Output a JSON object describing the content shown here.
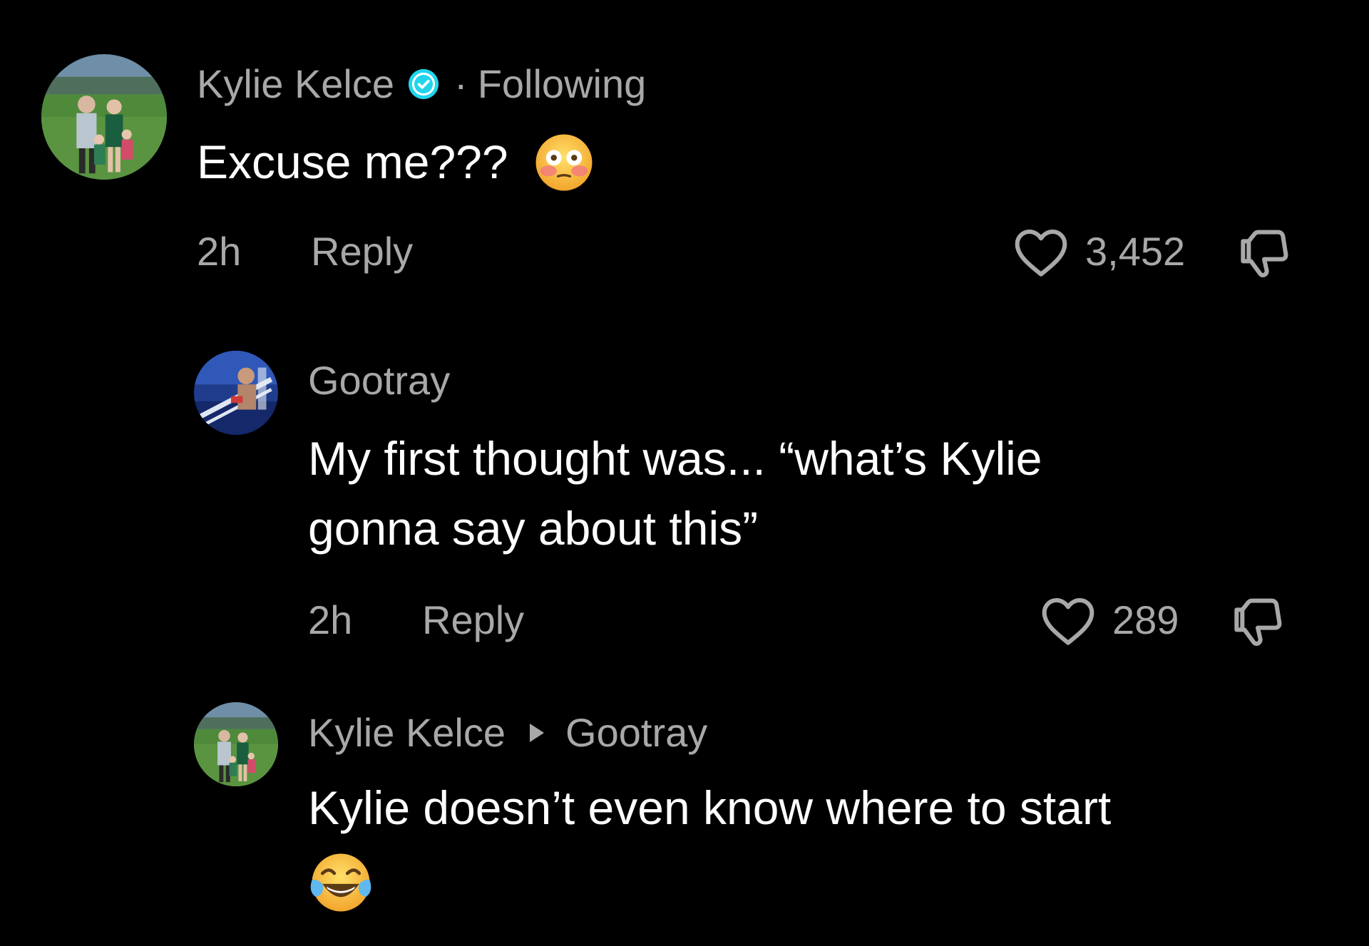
{
  "colors": {
    "background": "#000000",
    "primary_text": "#ffffff",
    "secondary_text": "#a8a8a8",
    "verified_badge": "#20d5ec"
  },
  "comments": [
    {
      "username": "Kylie Kelce",
      "verified": true,
      "separator": "·",
      "following_label": "Following",
      "text": "Excuse me???",
      "emoji": "flushed-face",
      "time": "2h",
      "reply_label": "Reply",
      "likes": "3,452",
      "avatar": "family-stadium-photo"
    },
    {
      "username": "Gootray",
      "text_line1": "My first thought was... “what’s Kylie",
      "text_line2": "gonna say about this”",
      "time": "2h",
      "reply_label": "Reply",
      "likes": "289",
      "avatar": "boxing-ring-photo"
    },
    {
      "username": "Kylie Kelce",
      "reply_to": "Gootray",
      "text": "Kylie doesn’t even know where to start",
      "emoji": "tears-of-joy-face",
      "avatar": "family-stadium-photo"
    }
  ]
}
